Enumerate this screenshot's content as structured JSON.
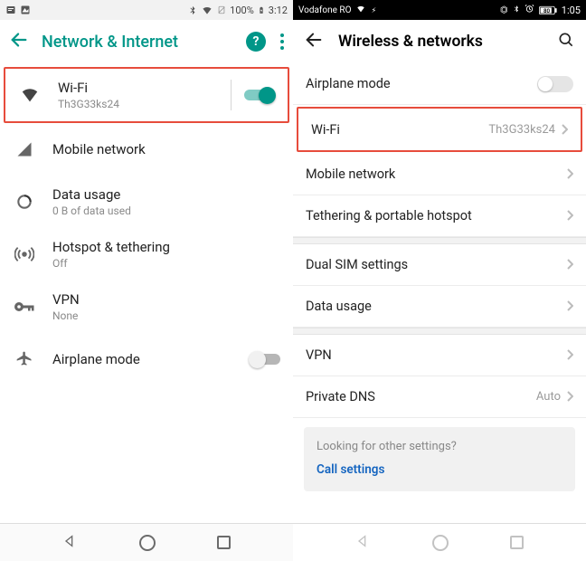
{
  "left": {
    "status": {
      "battery": "100%",
      "time": "3:12"
    },
    "header": {
      "title": "Network & Internet"
    },
    "items": {
      "wifi": {
        "label": "Wi-Fi",
        "sub": "Th3G33ks24",
        "toggle": true
      },
      "mobile": {
        "label": "Mobile network"
      },
      "data": {
        "label": "Data usage",
        "sub": "0 B of data used"
      },
      "hotspot": {
        "label": "Hotspot & tethering",
        "sub": "Off"
      },
      "vpn": {
        "label": "VPN",
        "sub": "None"
      },
      "airplane": {
        "label": "Airplane mode",
        "toggle": false
      }
    }
  },
  "right": {
    "status": {
      "carrier": "Vodafone RO",
      "time": "1:05",
      "battery": "80"
    },
    "header": {
      "title": "Wireless & networks"
    },
    "rows": {
      "airplane": {
        "label": "Airplane mode"
      },
      "wifi": {
        "label": "Wi-Fi",
        "value": "Th3G33ks24"
      },
      "mobile": {
        "label": "Mobile network"
      },
      "tether": {
        "label": "Tethering & portable hotspot"
      },
      "dualsim": {
        "label": "Dual SIM settings"
      },
      "datausage": {
        "label": "Data usage"
      },
      "vpn": {
        "label": "VPN"
      },
      "privatedns": {
        "label": "Private DNS",
        "value": "Auto"
      }
    },
    "promo": {
      "question": "Looking for other settings?",
      "link": "Call settings"
    }
  }
}
